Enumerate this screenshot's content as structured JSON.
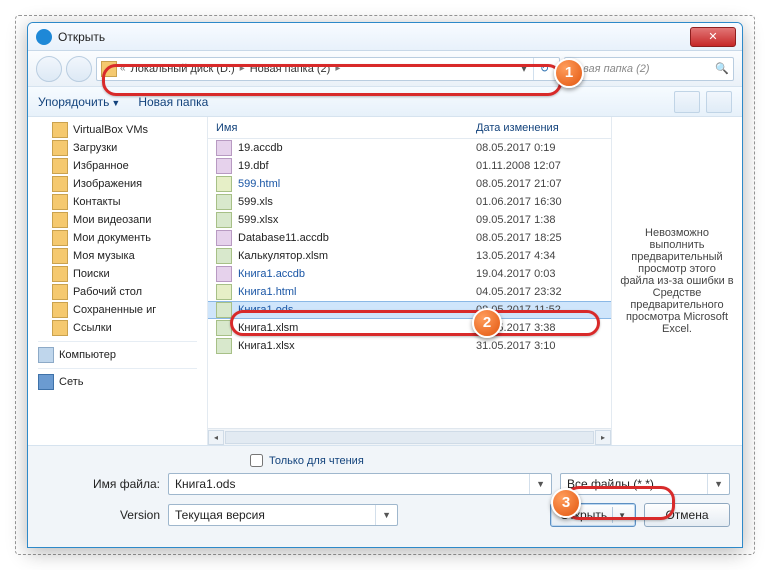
{
  "window": {
    "title": "Открыть"
  },
  "nav": {
    "path_prefix": "«",
    "segments": [
      "Локальный диск (D:)",
      "Новая папка (2)"
    ],
    "search_placeholder": "Новая папка (2)"
  },
  "toolbar": {
    "organize": "Упорядочить",
    "newfolder": "Новая папка"
  },
  "tree": {
    "items": [
      "VirtualBox VMs",
      "Загрузки",
      "Избранное",
      "Изображения",
      "Контакты",
      "Мои видеозапи",
      "Мои документь",
      "Моя музыка",
      "Поиски",
      "Рабочий стол",
      "Сохраненные иг",
      "Ссылки"
    ],
    "computer": "Компьютер",
    "network": "Сеть"
  },
  "list": {
    "col_name": "Имя",
    "col_date": "Дата изменения",
    "rows": [
      {
        "name": "19.accdb",
        "date": "08.05.2017 0:19",
        "type": "db"
      },
      {
        "name": "19.dbf",
        "date": "01.11.2008 12:07",
        "type": "db"
      },
      {
        "name": "599.html",
        "date": "08.05.2017 21:07",
        "type": "web",
        "link": true
      },
      {
        "name": "599.xls",
        "date": "01.06.2017 16:30",
        "type": "xls"
      },
      {
        "name": "599.xlsx",
        "date": "09.05.2017 1:38",
        "type": "xls"
      },
      {
        "name": "Database11.accdb",
        "date": "08.05.2017 18:25",
        "type": "db"
      },
      {
        "name": "Калькулятор.xlsm",
        "date": "13.05.2017 4:34",
        "type": "xls"
      },
      {
        "name": "Книга1.accdb",
        "date": "19.04.2017 0:03",
        "type": "db",
        "link": true
      },
      {
        "name": "Книга1.html",
        "date": "04.05.2017 23:32",
        "type": "web",
        "link": true
      },
      {
        "name": "Книга1.ods",
        "date": "08.05.2017 11:52",
        "type": "ods",
        "link": true,
        "selected": true
      },
      {
        "name": "Книга1.xlsm",
        "date": "02.05.2017 3:38",
        "type": "xls"
      },
      {
        "name": "Книга1.xlsx",
        "date": "31.05.2017 3:10",
        "type": "xls"
      }
    ]
  },
  "preview": {
    "message": "Невозможно выполнить предварительный просмотр этого файла из-за ошибки в Средстве предварительного просмотра Microsoft Excel."
  },
  "lower": {
    "readonly": "Только для чтения",
    "filename_label": "Имя файла:",
    "filename_value": "Книга1.ods",
    "filter": "Все файлы (*.*)",
    "version_label": "Version",
    "version_value": "Текущая версия",
    "open": "Открыть",
    "cancel": "Отмена"
  },
  "callouts": {
    "b1": "1",
    "b2": "2",
    "b3": "3"
  }
}
